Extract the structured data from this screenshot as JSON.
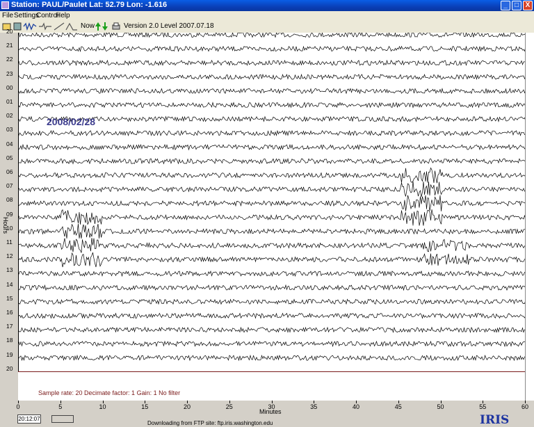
{
  "window": {
    "title": "Station: PAUL/Paulet Lat: 52.79 Lon: -1.616",
    "min_glyph": "_",
    "max_glyph": "□",
    "close_glyph": "X"
  },
  "menu": [
    "File",
    "Settings",
    "Control",
    "Help"
  ],
  "toolbar": {
    "now_label": "Now",
    "version": "Version 2.0 Level 2007.07.18"
  },
  "seismogram": {
    "date_label": "2008/02/28",
    "hour_labels": [
      "20",
      "21",
      "22",
      "23",
      "00",
      "01",
      "02",
      "03",
      "04",
      "05",
      "06",
      "07",
      "08",
      "09",
      "10",
      "11",
      "12",
      "13",
      "14",
      "15",
      "16",
      "17",
      "18",
      "19",
      "20"
    ],
    "y_axis_label": "Hours",
    "status_text": "Sample rate: 20   Decimate factor: 1   Gain: 1   No filter",
    "line_color": "#000000",
    "separator_color": "#7a1a1a"
  },
  "x_axis": {
    "ticks": [
      "0",
      "5",
      "10",
      "15",
      "20",
      "25",
      "30",
      "35",
      "40",
      "45",
      "50",
      "55",
      "60"
    ],
    "label": "Minutes"
  },
  "footer": {
    "time": "20:12:07",
    "download_text": "Downloading from FTP site: ftp.iris.washington.edu",
    "logo": "IRIS"
  }
}
